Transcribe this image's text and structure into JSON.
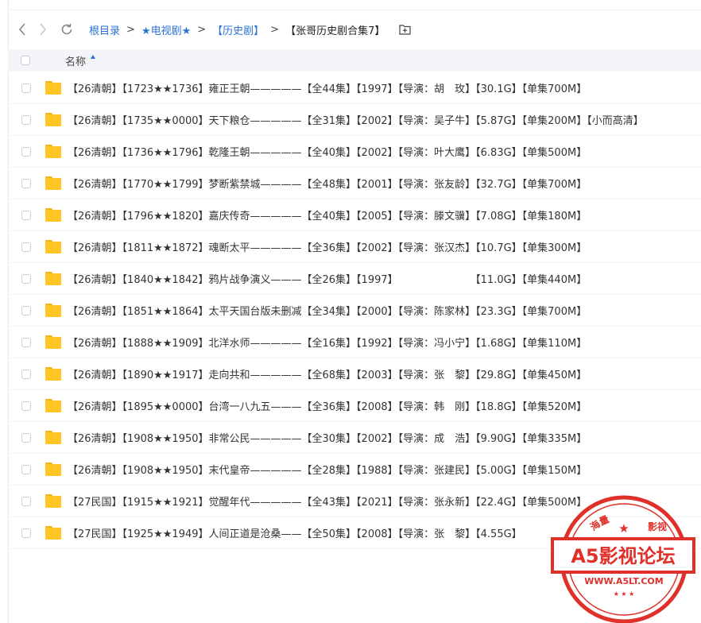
{
  "nav": {
    "breadcrumb": [
      "根目录",
      "★电视剧★",
      "【历史剧】"
    ],
    "separator": ">",
    "current": "【张哥历史剧合集7】"
  },
  "header": {
    "name_label": "名称"
  },
  "files": [
    "【26清朝】【1723★★1736】雍正王朝—————【全44集】【1997】【导演：胡　玫】【30.1G】【单集700M】",
    "【26清朝】【1735★★0000】天下粮仓—————【全31集】【2002】【导演：吴子牛】【5.87G】【单集200M】【小而高清】",
    "【26清朝】【1736★★1796】乾隆王朝—————【全40集】【2002】【导演：叶大鹰】【6.83G】【单集500M】",
    "【26清朝】【1770★★1799】梦断紫禁城————【全48集】【2001】【导演：张友龄】【32.7G】【单集700M】",
    "【26清朝】【1796★★1820】嘉庆传奇—————【全40集】【2005】【导演：滕文骥】【7.08G】【单集180M】",
    "【26清朝】【1811★★1872】魂断太平—————【全36集】【2002】【导演：张汉杰】【10.7G】【单集300M】",
    "【26清朝】【1840★★1842】鸦片战争演义———【全26集】【1997】　　　　　　　　【11.0G】【单集440M】",
    "【26清朝】【1851★★1864】太平天国台版未删减【全34集】【2000】【导演：陈家林】【23.3G】【单集700M】",
    "【26清朝】【1888★★1909】北洋水师—————【全16集】【1992】【导演：冯小宁】【1.68G】【单集110M】",
    "【26清朝】【1890★★1917】走向共和—————【全68集】【2003】【导演：张　黎】【29.8G】【单集450M】",
    "【26清朝】【1895★★0000】台湾一八九五———【全36集】【2008】【导演：韩　刚】【18.8G】【单集520M】",
    "【26清朝】【1908★★1950】非常公民—————【全30集】【2002】【导演：成　浩】【9.90G】【单集335M】",
    "【26清朝】【1908★★1950】末代皇帝—————【全28集】【1988】【导演：张建民】【5.00G】【单集150M】",
    "【27民国】【1915★★1921】觉醒年代—————【全43集】【2021】【导演：张永新】【22.4G】【单集500M】",
    "【27民国】【1925★★1949】人间正道是沧桑——【全50集】【2008】【导演：张　黎】【4.55G】"
  ],
  "watermark": {
    "top_text": "海量",
    "top_text2": "影视",
    "main_text": "A5影视论坛",
    "url": "WWW.A5LT.COM",
    "color": "#e0302a"
  },
  "colors": {
    "link": "#2b72d4",
    "folder": "#ffc626",
    "header_bg": "#f4f5f8"
  }
}
